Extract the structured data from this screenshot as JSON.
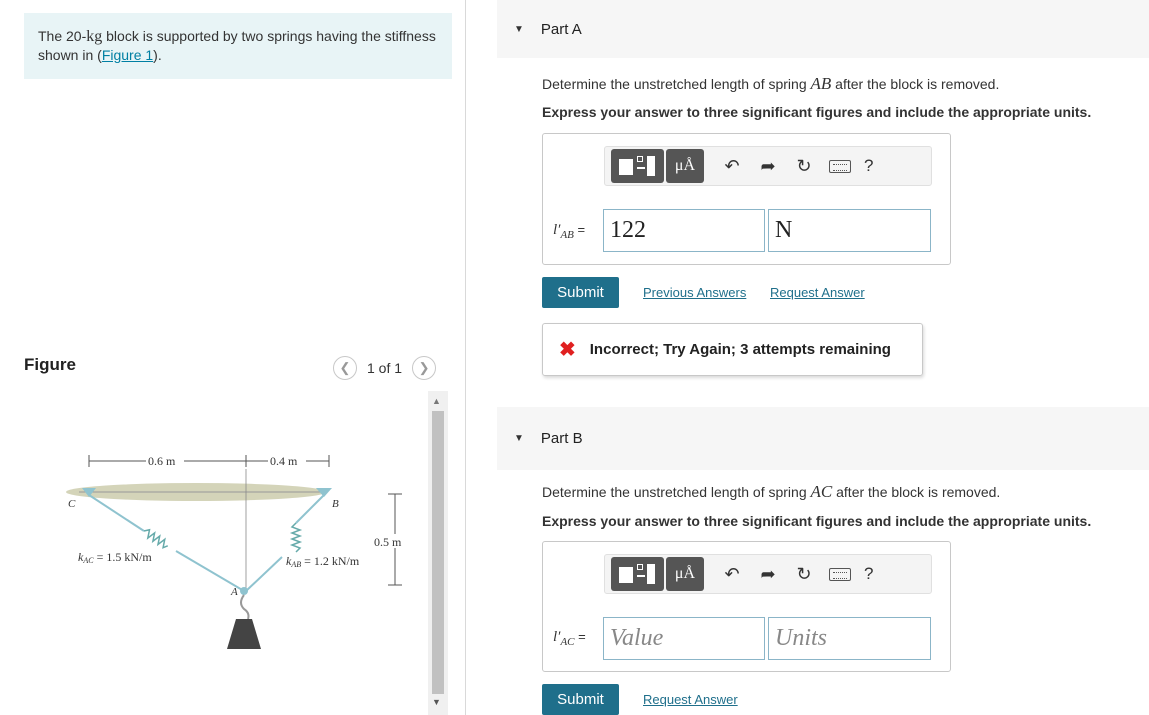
{
  "problem": {
    "text_before": "The 20-",
    "mass_unit": "kg",
    "text_after": " block is supported by two springs having the stiffness shown in (",
    "figure_link": "Figure 1",
    "text_close": ")."
  },
  "figure": {
    "label": "Figure",
    "pager_text": "1 of 1",
    "prev_icon": "chevron-left-icon",
    "next_icon": "chevron-right-icon",
    "dim_left": "0.6 m",
    "dim_right": "0.4 m",
    "dim_height": "0.5 m",
    "point_c": "C",
    "point_b": "B",
    "point_a": "A",
    "k_ac": "k",
    "k_ac_sub": "AC",
    "k_ac_value": " = 1.5 kN/m",
    "k_ab": "k",
    "k_ab_sub": "AB",
    "k_ab_value": " = 1.2 kN/m"
  },
  "part_a": {
    "title": "Part A",
    "question_before": "Determine the unstretched length of spring ",
    "question_var": "AB",
    "question_after": " after the block is removed.",
    "instruction": "Express your answer to three significant figures and include the appropriate units.",
    "var_main": "l′",
    "var_sub": "AB",
    "var_eq": " =",
    "value": "122",
    "units": "N",
    "submit": "Submit",
    "previous_answers": "Previous Answers",
    "request_answer": "Request Answer",
    "feedback": "Incorrect; Try Again; 3 attempts remaining"
  },
  "part_b": {
    "title": "Part B",
    "question_before": "Determine the unstretched length of spring ",
    "question_var": "AC",
    "question_after": " after the block is removed.",
    "instruction": "Express your answer to three significant figures and include the appropriate units.",
    "var_main": "l′",
    "var_sub": "AC",
    "var_eq": " =",
    "value_placeholder": "Value",
    "units_placeholder": "Units",
    "submit": "Submit",
    "request_answer": "Request Answer"
  },
  "toolbar": {
    "mu_label": "μÅ",
    "help": "?"
  },
  "colors": {
    "accent": "#1f6f8b",
    "error": "#e02020",
    "intro_bg": "#e8f4f6"
  }
}
